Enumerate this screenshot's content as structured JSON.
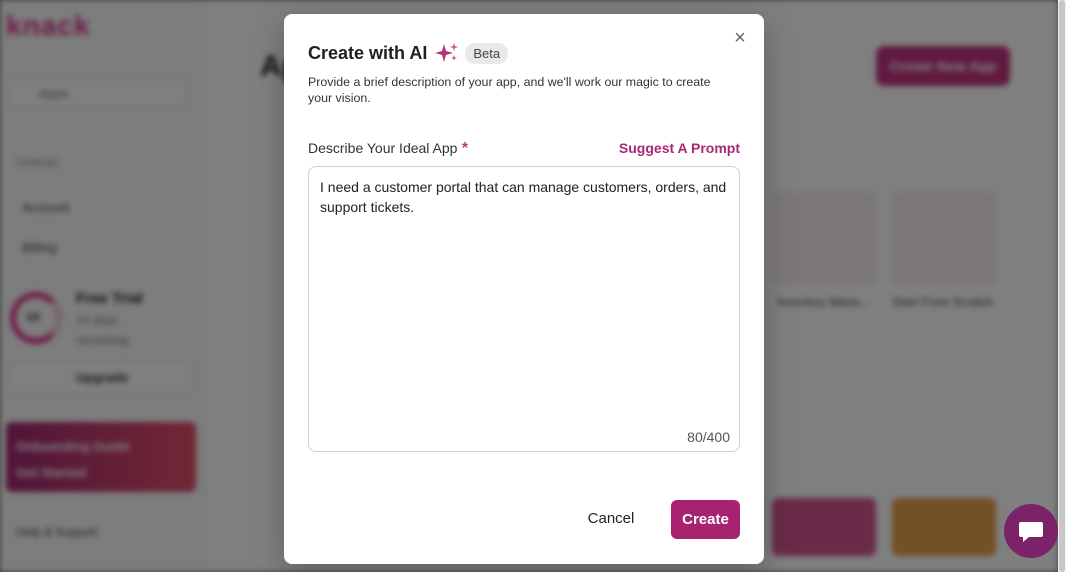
{
  "background": {
    "logo": "knack",
    "search_placeholder": "Apps",
    "section_label": "Settings",
    "nav_items": [
      "Account",
      "Billing"
    ],
    "trial": {
      "days": "14",
      "title": "Free Trial",
      "sub1": "14 days",
      "sub2": "remaining"
    },
    "upgrade_label": "Upgrade",
    "promo_lines": [
      "Onboarding Guide",
      "Get Started"
    ],
    "footer_label": "Help & Support",
    "heading": "Apps",
    "top_button": "Create New App",
    "card_labels": [
      "Inventory Mana...",
      "Start From Scratch"
    ]
  },
  "modal": {
    "title": "Create with AI",
    "badge": "Beta",
    "description": "Provide a brief description of your app, and we'll work our magic to create your vision.",
    "field_label": "Describe Your Ideal App",
    "required_mark": "*",
    "suggest_label": "Suggest A Prompt",
    "textarea_value": "I need a customer portal that can manage customers, orders, and support tickets.",
    "char_count": "80/400",
    "cancel_label": "Cancel",
    "create_label": "Create",
    "close_symbol": "×"
  },
  "colors": {
    "accent": "#a8236f",
    "link": "#a62a75",
    "chat": "#7b2268"
  },
  "icons": {
    "close": "close-icon",
    "sparkle": "sparkle-icon",
    "chat": "chat-icon"
  }
}
